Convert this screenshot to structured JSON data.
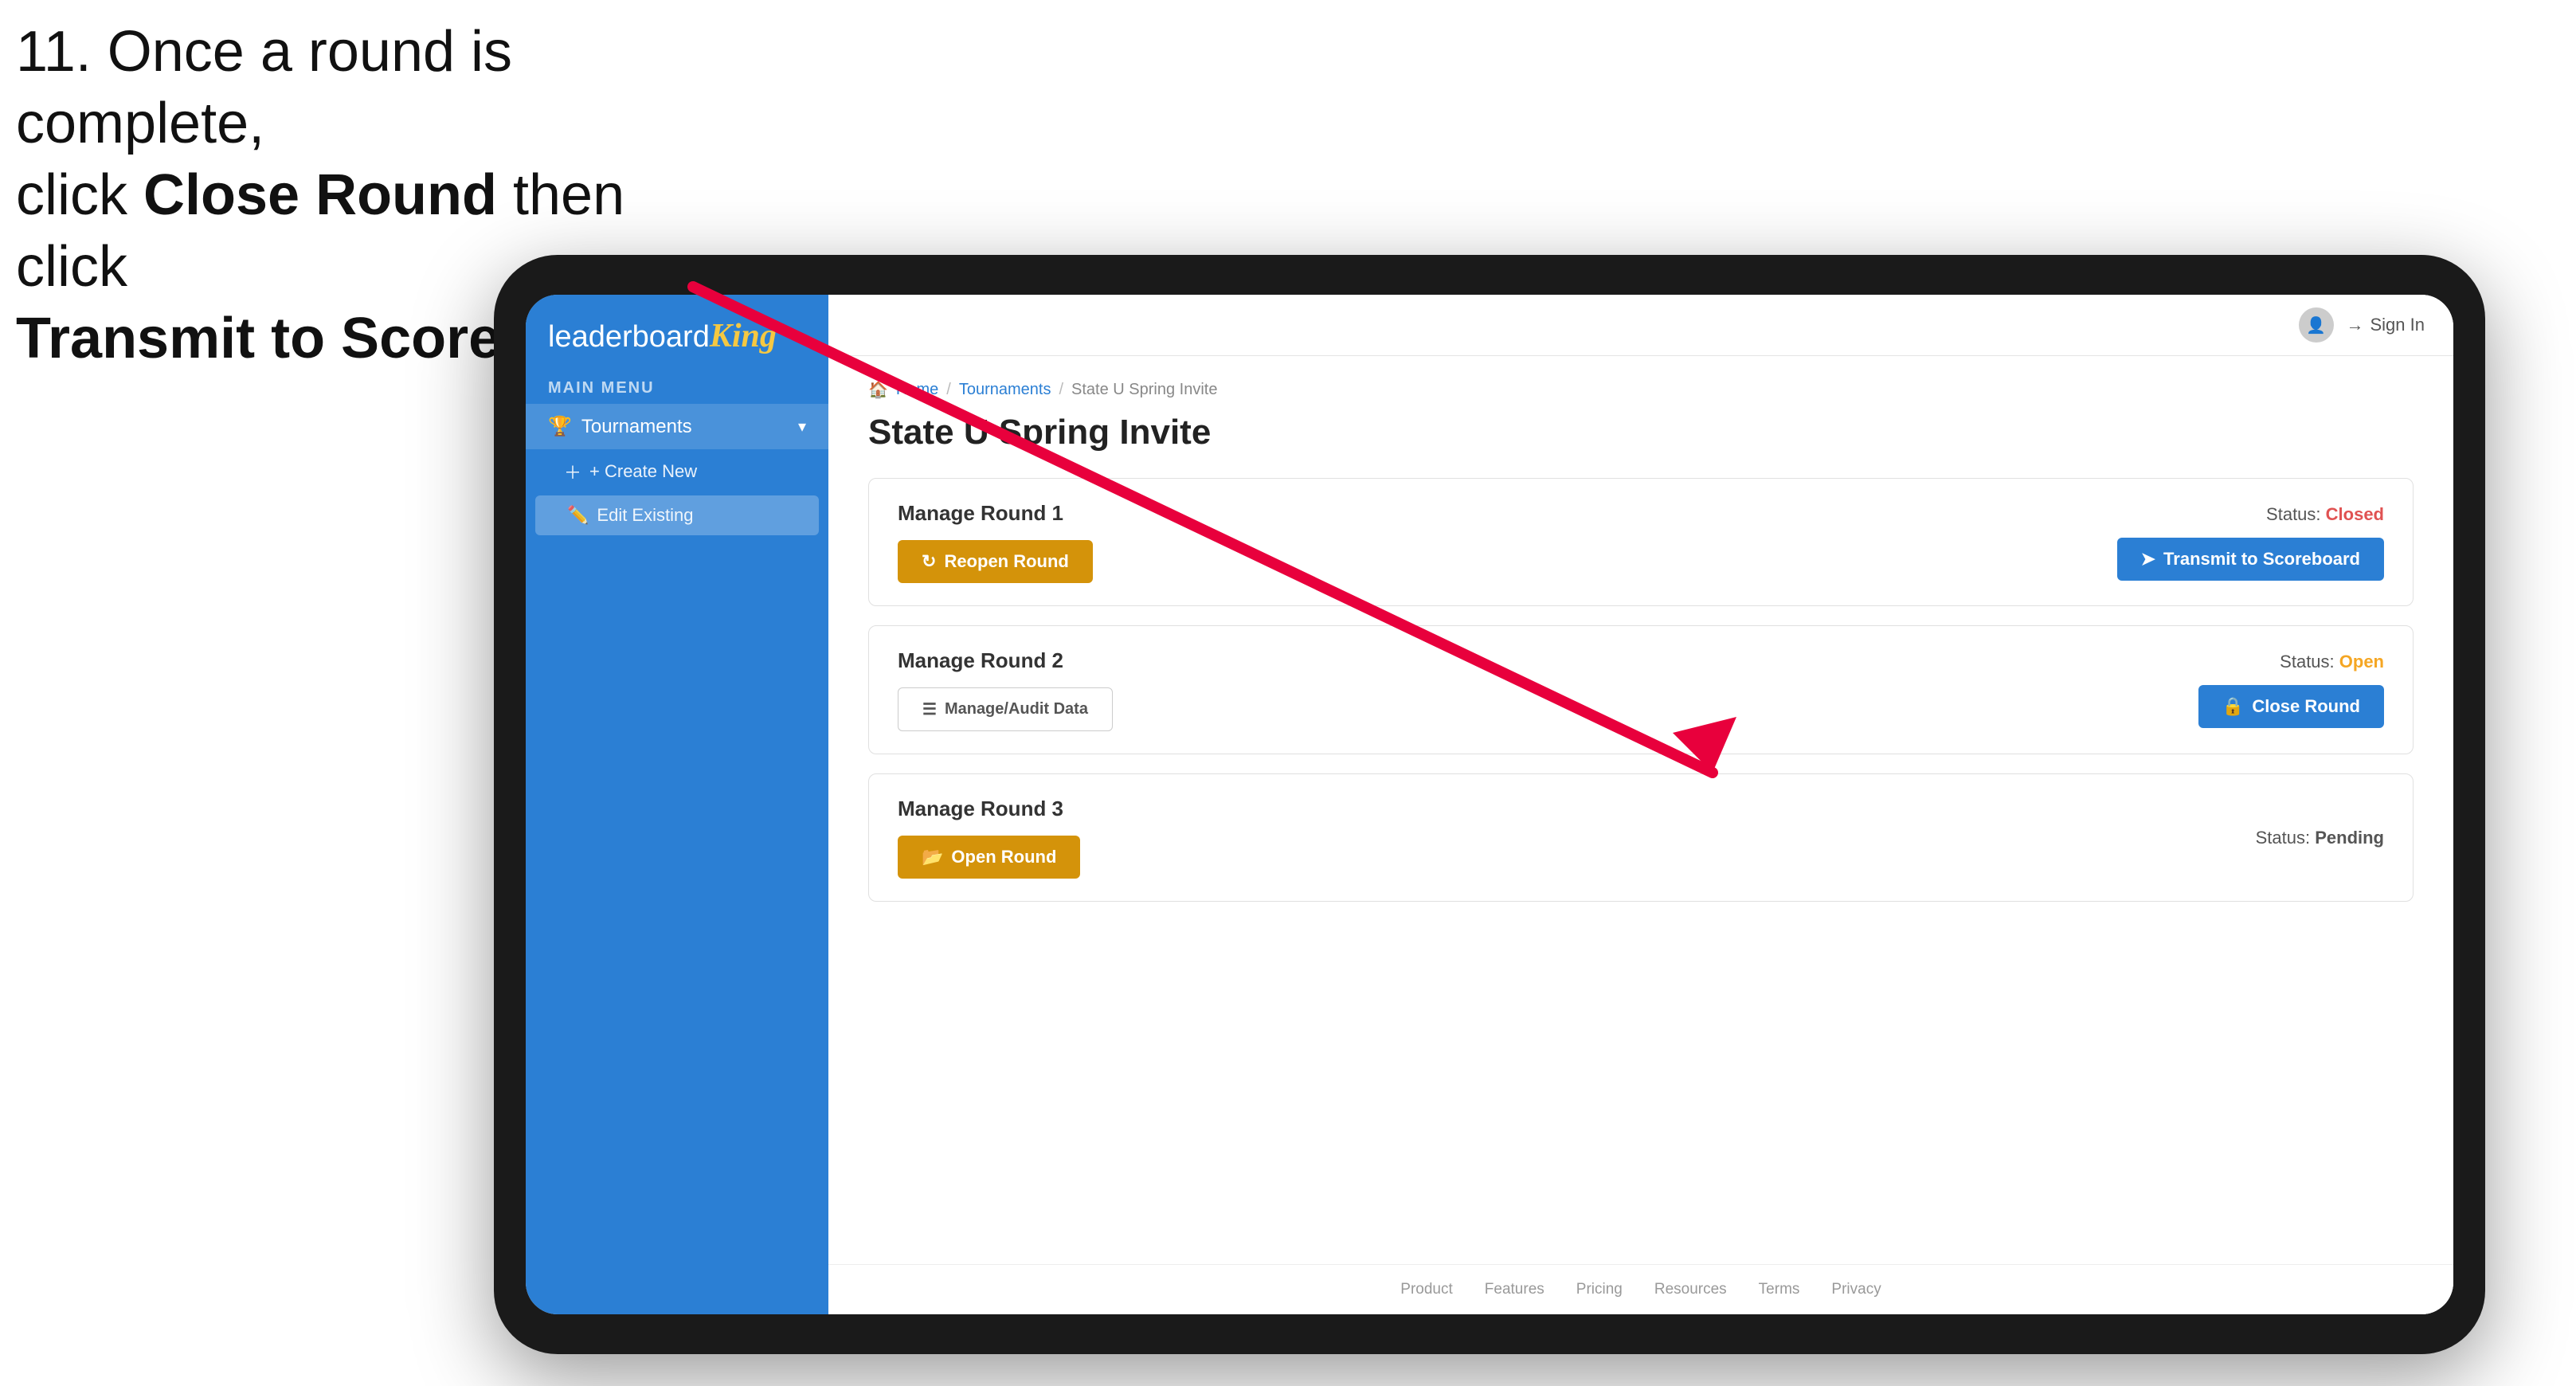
{
  "instruction": {
    "line1": "11. Once a round is complete,",
    "line2": "click ",
    "bold1": "Close Round",
    "line3": " then click",
    "bold2": "Transmit to Scoreboard."
  },
  "header": {
    "avatar_icon": "👤",
    "sign_in_label": "Sign In"
  },
  "sidebar": {
    "logo_part1": "leaderboard",
    "logo_part2": "King",
    "main_menu_label": "MAIN MENU",
    "tournaments_label": "Tournaments",
    "create_new_label": "+ Create New",
    "edit_existing_label": "Edit Existing"
  },
  "breadcrumb": {
    "home": "Home",
    "sep1": "/",
    "tournaments": "Tournaments",
    "sep2": "/",
    "current": "State U Spring Invite"
  },
  "page": {
    "title": "State U Spring Invite"
  },
  "rounds": [
    {
      "id": "round1",
      "title": "Manage Round 1",
      "status_label": "Status:",
      "status_value": "Closed",
      "status_class": "status-closed",
      "left_btn_label": "Reopen Round",
      "left_btn_icon": "↻",
      "right_btn_label": "Transmit to Scoreboard",
      "right_btn_icon": "➤",
      "right_btn_type": "blue"
    },
    {
      "id": "round2",
      "title": "Manage Round 2",
      "status_label": "Status:",
      "status_value": "Open",
      "status_class": "status-open",
      "left_btn_label": "Manage/Audit Data",
      "left_btn_icon": "☰",
      "right_btn_label": "Close Round",
      "right_btn_icon": "🔒",
      "right_btn_type": "blue"
    },
    {
      "id": "round3",
      "title": "Manage Round 3",
      "status_label": "Status:",
      "status_value": "Pending",
      "status_class": "status-pending",
      "left_btn_label": "Open Round",
      "left_btn_icon": "📂",
      "right_btn_label": null,
      "right_btn_type": null
    }
  ],
  "footer": {
    "links": [
      "Product",
      "Features",
      "Pricing",
      "Resources",
      "Terms",
      "Privacy"
    ]
  }
}
